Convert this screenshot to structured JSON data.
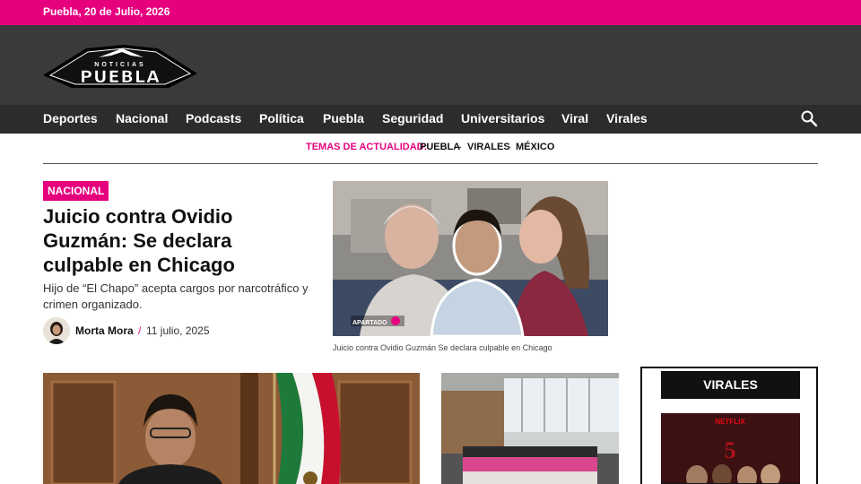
{
  "topbar": {
    "date": "Puebla, 20 de Julio, 2026"
  },
  "brand": {
    "logo_top": "NOTICIAS",
    "logo_main": "PUEBLA",
    "accent": "#e6007e"
  },
  "nav": {
    "items": [
      "Deportes",
      "Nacional",
      "Podcasts",
      "Política",
      "Puebla",
      "Seguridad",
      "Universitarios",
      "Viral",
      "Virales"
    ],
    "search_icon": "search-icon"
  },
  "topics": {
    "label": "TEMAS DE ACTUALIDAD:",
    "items": [
      "PUEBLA",
      "VIRALES",
      "MÉXICO"
    ],
    "separator": "-"
  },
  "featured": {
    "category": "NACIONAL",
    "title": "Juicio contra Ovidio Guzmán: Se declara culpable en Chicago",
    "dek": "Hijo de “El Chapo” acepta cargos por narcotráfico y crimen organizado.",
    "author": "Morta Mora",
    "author_sep": "/",
    "date": "11 julio, 2025",
    "image_caption": "Juicio contra Ovidio Guzmán Se declara culpable en Chicago",
    "image_watermark": "APARTADO"
  },
  "sidebar": {
    "virales_title": "VIRALES",
    "virales_image_brand": "NETFLIX"
  }
}
